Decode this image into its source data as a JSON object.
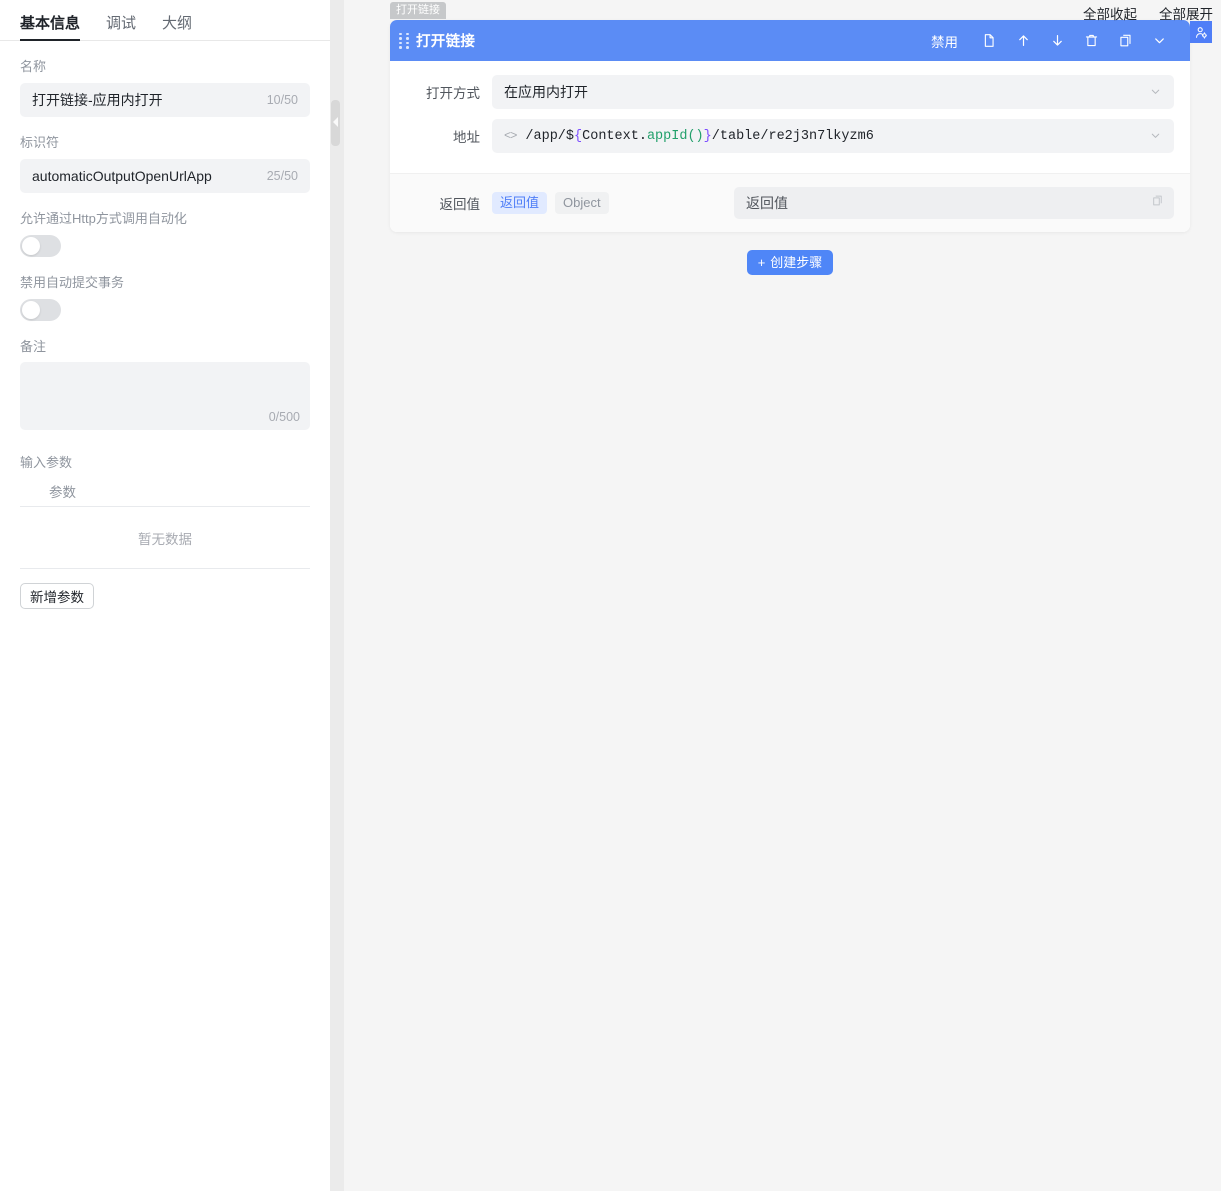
{
  "sidebar": {
    "tabs": [
      {
        "label": "基本信息",
        "active": true
      },
      {
        "label": "调试",
        "active": false
      },
      {
        "label": "大纲",
        "active": false
      }
    ],
    "fields": {
      "name_label": "名称",
      "name_value": "打开链接-应用内打开",
      "name_counter": "10/50",
      "key_label": "标识符",
      "key_value": "automaticOutputOpenUrlApp",
      "key_counter": "25/50",
      "http_label": "允许通过Http方式调用自动化",
      "http_switch_state": "off",
      "txn_label": "禁用自动提交事务",
      "txn_switch_state": "off",
      "remark_label": "备注",
      "remark_value": "",
      "remark_counter": "0/500"
    },
    "params": {
      "section_label": "输入参数",
      "column_header": "参数",
      "empty_text": "暂无数据",
      "add_button": "新增参数"
    }
  },
  "right": {
    "top_links": [
      {
        "label": "全部收起"
      },
      {
        "label": "全部展开"
      }
    ],
    "user_icon": "user-settings-icon",
    "node_tag": "打开链接",
    "card": {
      "title": "打开链接",
      "drag_handle": "drag-dots-icon",
      "toolbar": {
        "disable_label": "禁用",
        "icons": [
          {
            "name": "document-icon"
          },
          {
            "name": "arrow-up-icon"
          },
          {
            "name": "arrow-down-icon"
          },
          {
            "name": "trash-icon"
          },
          {
            "name": "copy-icon"
          },
          {
            "name": "chevron-down-icon"
          }
        ]
      },
      "rows": [
        {
          "label": "打开方式",
          "type": "select",
          "value": "在应用内打开"
        },
        {
          "label": "地址",
          "type": "code",
          "value": "/app/${Context.appId()}/table/re2j3n7lkyzm6",
          "tokens": [
            {
              "t": "/app/$",
              "c": "plain"
            },
            {
              "t": "{",
              "c": "brace"
            },
            {
              "t": "Context.",
              "c": "plain"
            },
            {
              "t": "appId()",
              "c": "fn"
            },
            {
              "t": "}",
              "c": "brace"
            },
            {
              "t": "/table/re2j3n7lkyzm6",
              "c": "plain"
            }
          ]
        }
      ],
      "return": {
        "label": "返回值",
        "badge_name": "返回值",
        "badge_type": "Object",
        "input_value": "返回值",
        "input_icon": "copy-icon"
      }
    },
    "create_step_button": "创建步骤",
    "create_step_plus": "+"
  },
  "colors": {
    "accent": "#4f86f7",
    "card_header": "#5b8cf5",
    "badge_blue_bg": "#e1eaff",
    "badge_blue_text": "#4f7ef7",
    "canvas_bg": "#f5f5f5",
    "input_bg": "#f2f3f5",
    "token_brace": "#7c4dff",
    "token_fn": "#22a06b"
  }
}
